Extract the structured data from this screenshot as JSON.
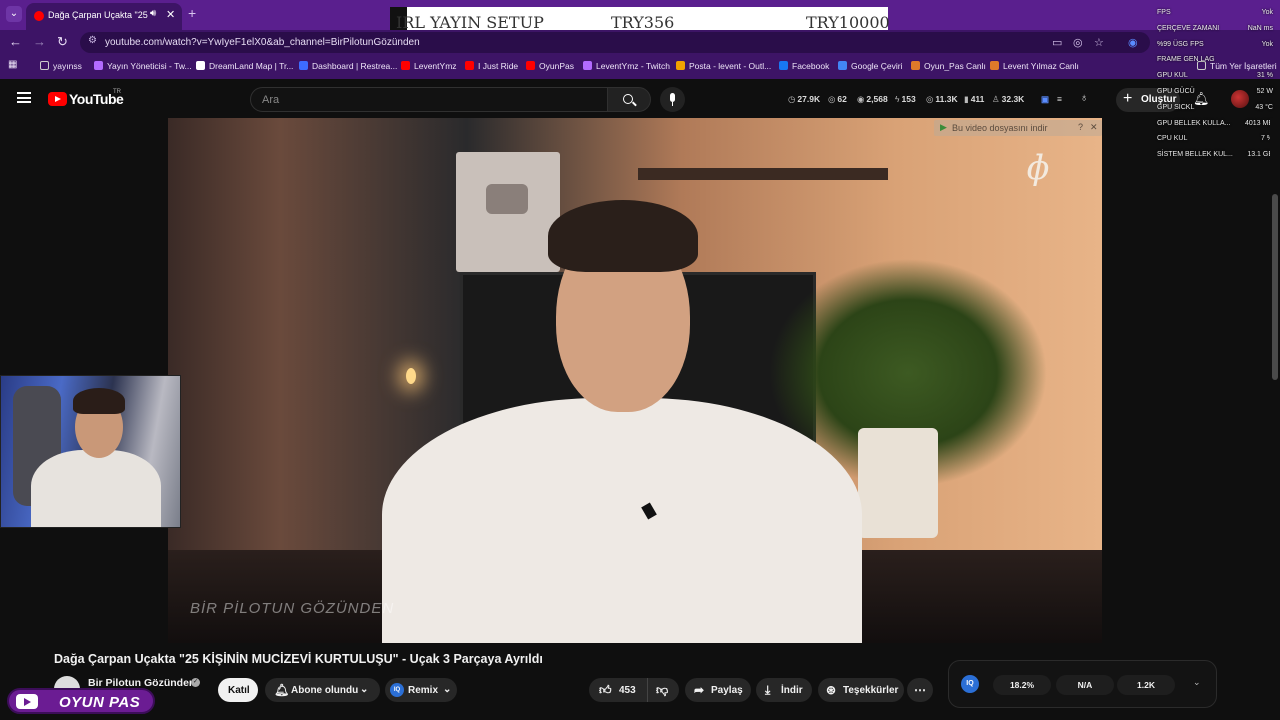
{
  "browser": {
    "tab_title": "Dağa Çarpan Uçakta \"25 Kİ",
    "url": "youtube.com/watch?v=YwIyeF1elX0&ab_channel=BirPilotunGözünden",
    "bookmarks": [
      "yayınss",
      "Yayın Yöneticisi - Tw...",
      "DreamLand Map | Tr...",
      "Dashboard | Restrea...",
      "LeventYmz",
      "I Just Ride",
      "OyunPas",
      "LeventYmz - Twitch",
      "Posta - levent - Outl...",
      "Facebook",
      "Google Çeviri",
      "Oyun_Pas Canlı",
      "Levent Yılmaz Canlı",
      "Tüm Yer İşaretleri"
    ]
  },
  "overlay_banner": {
    "title": "IRL YAYIN SETUP",
    "amount_current": "TRY356",
    "amount_goal": "TRY10000"
  },
  "perf_overlay": {
    "rows": [
      {
        "label": "FPS",
        "value": "Yok"
      },
      {
        "label": "ÇERÇEVE ZAMANI",
        "value": "NaN ms"
      },
      {
        "label": "%99 ÜSG FPS",
        "value": "Yok"
      },
      {
        "label": "FRAME GEN LAG",
        "value": ""
      },
      {
        "label": "GPU KUL",
        "value": "31 %"
      },
      {
        "label": "GPU GÜCÜ",
        "value": "52 W"
      },
      {
        "label": "GPU SICKL",
        "value": "43 °C"
      },
      {
        "label": "GPU BELLEK KULLA...",
        "value": "4013 MB"
      },
      {
        "label": "CPU KUL",
        "value": "7 %"
      },
      {
        "label": "SİSTEM BELLEK KUL...",
        "value": "13.1 GB"
      }
    ]
  },
  "youtube_header": {
    "logo_text": "YouTube",
    "logo_region": "TR",
    "search_placeholder": "Ara",
    "stats": [
      "27.9K",
      "62",
      "2,568",
      "153",
      "11.3K",
      "411",
      "32.3K"
    ],
    "create_label": "Oluştur"
  },
  "video": {
    "file_notice": "Bu video dosyasını indir",
    "watermark": "BİR PİLOTUN GÖZÜNDEN"
  },
  "stream_brand": {
    "name": "OYUN PAS"
  },
  "details": {
    "title": "Dağa Çarpan Uçakta \"25 KİŞİNİN MUCİZEVİ KURTULUŞU\" - Uçak 3 Parçaya Ayrıldı",
    "channel_name": "Bir Pilotun Gözünden",
    "join_label": "Katıl",
    "subscribe_label": "Abone olundu",
    "remix_label": "Remix",
    "like_count": "453",
    "share_label": "Paylaş",
    "download_label": "İndir",
    "thanks_label": "Teşekkürler"
  },
  "iq_panel": {
    "values": [
      "18.2%",
      "N/A",
      "1.2K"
    ]
  },
  "colors": {
    "browser_accent": "#5a1f8e",
    "youtube_red": "#ff0000",
    "page_bg": "#0f0f0f"
  }
}
